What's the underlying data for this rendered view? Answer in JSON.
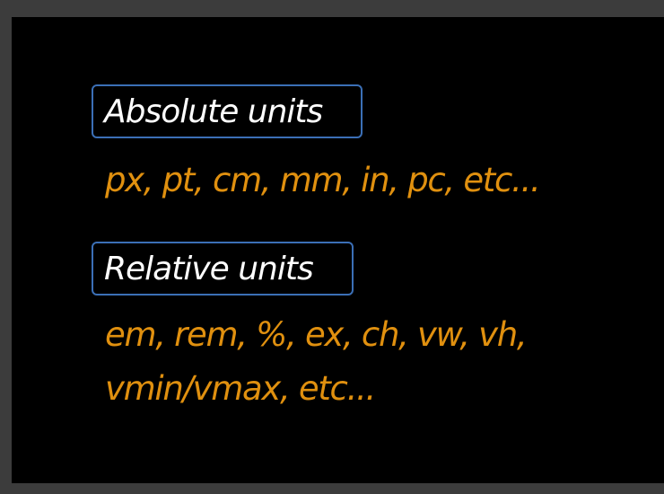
{
  "slide": {
    "absolute": {
      "heading": "Absolute units",
      "examples": "px, pt, cm, mm, in, pc, etc..."
    },
    "relative": {
      "heading": "Relative units",
      "examples_line1": "em, rem, %, ex, ch, vw, vh,",
      "examples_line2": "vmin/vmax, etc..."
    }
  },
  "colors": {
    "background": "#000000",
    "frame": "#3c3c3c",
    "heading_text": "#ffffff",
    "heading_border": "#3b6fb6",
    "example_text": "#e0900f"
  }
}
